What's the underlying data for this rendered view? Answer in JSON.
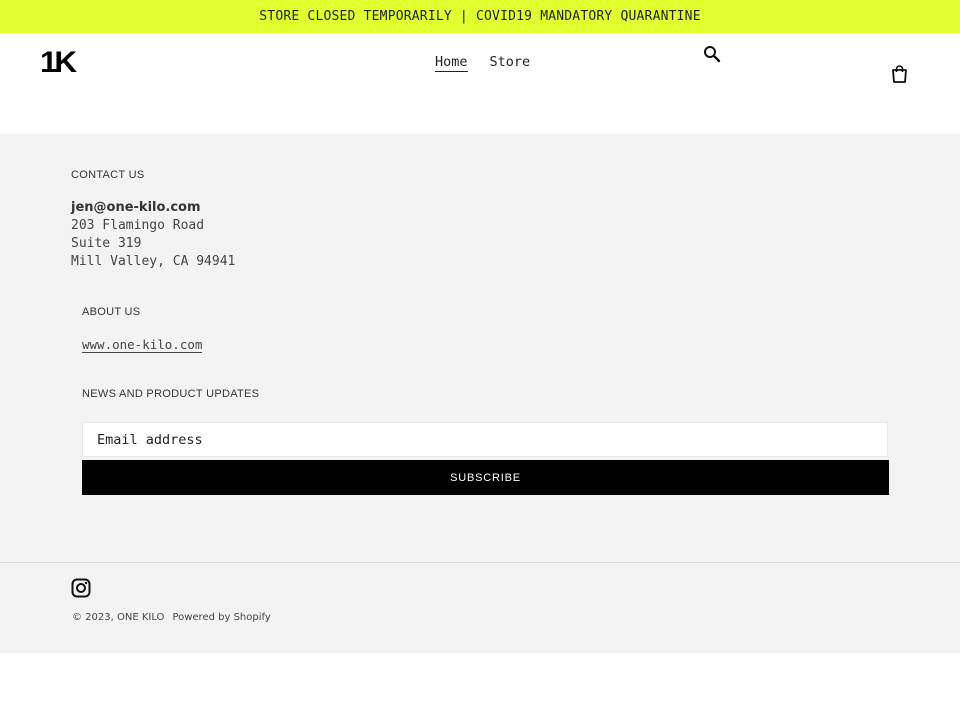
{
  "announcement": {
    "text": "STORE CLOSED TEMPORARILY | COVID19 MANDATORY QUARANTINE",
    "background_color": "#e2ff2f"
  },
  "header": {
    "logo_text": "1K",
    "nav": [
      {
        "label": "Home",
        "active": true
      },
      {
        "label": "Store",
        "active": false
      }
    ],
    "icons": [
      "search-icon",
      "cart-icon"
    ]
  },
  "footer": {
    "contact": {
      "title": "CONTACT US",
      "email": "jen@one-kilo.com",
      "address_lines": [
        "203 Flamingo Road",
        "Suite 319",
        "Mill Valley, CA 94941"
      ]
    },
    "about": {
      "title": "ABOUT US",
      "link_text": "www.one-kilo.com"
    },
    "newsletter": {
      "title": "NEWS AND PRODUCT UPDATES",
      "placeholder": "Email address",
      "button_label": "SUBSCRIBE"
    },
    "social_icons": [
      "instagram-icon"
    ],
    "copyright": "© 2023, ONE KILO",
    "powered_by": "Powered by Shopify"
  }
}
